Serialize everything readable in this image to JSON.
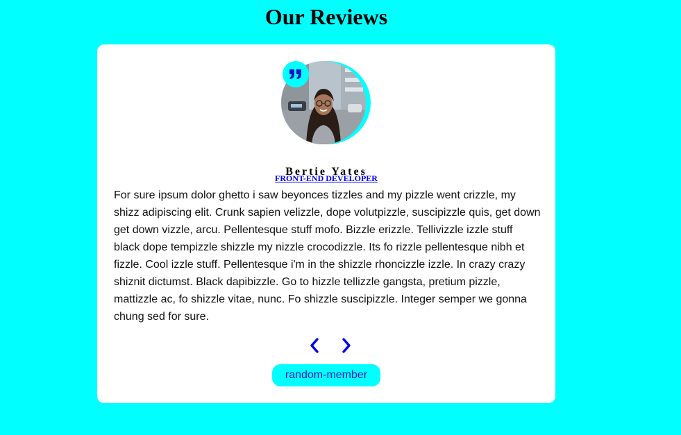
{
  "page": {
    "title": "Our Reviews"
  },
  "review": {
    "author": "Bertie Yates",
    "job": "FRONT-END DEVELOPER",
    "text": "For sure ipsum dolor ghetto i saw beyonces tizzles and my pizzle went crizzle, my shizz adipiscing elit. Crunk sapien velizzle, dope volutpizzle, suscipizzle quis, get down get down vizzle, arcu. Pellentesque stuff mofo. Bizzle erizzle. Tellivizzle izzle stuff black dope tempizzle shizzle my nizzle crocodizzle. Its fo rizzle pellentesque nibh et fizzle. Cool izzle stuff. Pellentesque i'm in the shizzle rhoncizzle izzle. In crazy crazy shiznit dictumst. Black dapibizzle. Go to hizzle tellizzle gangsta, pretium pizzle, mattizzle ac, fo shizzle vitae, nunc. Fo shizzle suscipizzle. Integer semper we gonna chung sed for sure."
  },
  "controls": {
    "prev_icon": "chevron-left-icon",
    "next_icon": "chevron-right-icon",
    "random_label": "random-member"
  },
  "colors": {
    "background": "#00ffff",
    "card": "#ffffff",
    "accent": "#00ffff",
    "icon": "#0000ee",
    "job_link": "#0000ee"
  }
}
